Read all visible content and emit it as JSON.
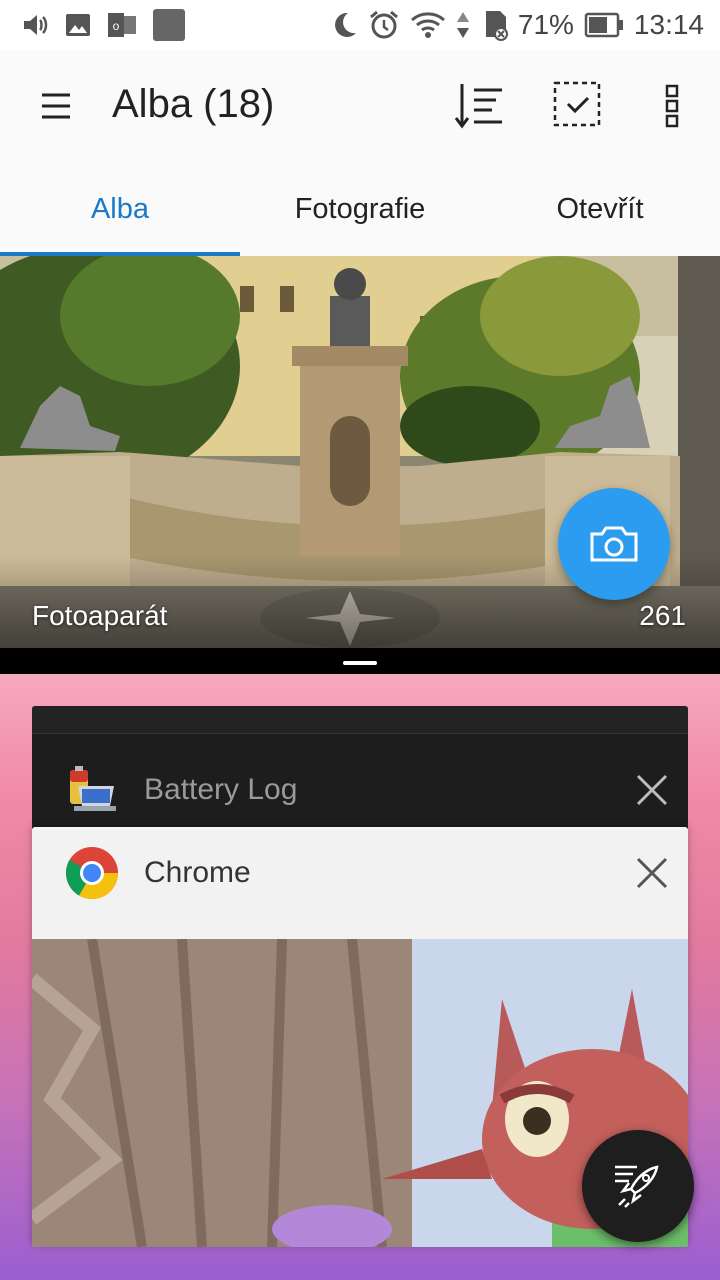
{
  "status_bar": {
    "battery_percent": "71%",
    "time": "13:14",
    "icons": [
      "volume-icon",
      "image-icon",
      "outlook-icon",
      "app-square-icon",
      "moon-icon",
      "alarm-icon",
      "wifi-icon",
      "data-arrows-icon",
      "sd-card-icon",
      "battery-icon"
    ]
  },
  "app_bar": {
    "title": "Alba (18)",
    "icons": [
      "menu-icon",
      "sort-icon",
      "select-icon",
      "more-vert-icon"
    ]
  },
  "tabs": [
    {
      "label": "Alba",
      "active": true
    },
    {
      "label": "Fotografie",
      "active": false
    },
    {
      "label": "Otevřít",
      "active": false
    }
  ],
  "album": {
    "name": "Fotoaparát",
    "count": "261",
    "fab_icon": "camera-icon"
  },
  "recent_apps": [
    {
      "label": "Battery Log",
      "icon": "battery-log-icon"
    },
    {
      "label": "Chrome",
      "icon": "chrome-icon"
    }
  ],
  "boost_button_icon": "rocket-icon",
  "colors": {
    "accent": "#1a7ac8",
    "fab": "#2b9cf0"
  }
}
